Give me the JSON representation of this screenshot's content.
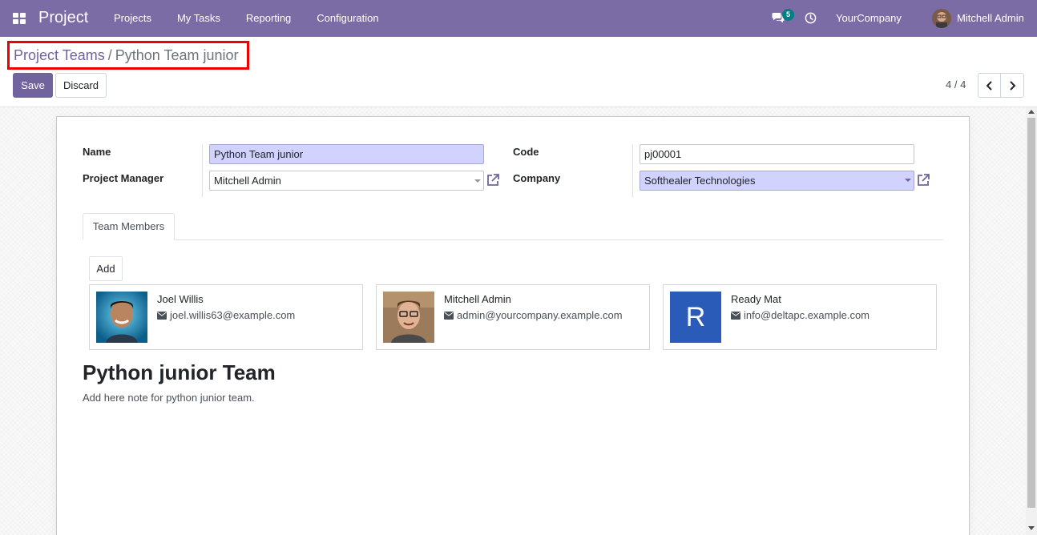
{
  "navbar": {
    "app_name": "Project",
    "menu": [
      "Projects",
      "My Tasks",
      "Reporting",
      "Configuration"
    ],
    "chat_badge": "5",
    "company": "YourCompany",
    "user": "Mitchell Admin",
    "bg_color": "#7c6ca6"
  },
  "breadcrumb": {
    "parent": "Project Teams",
    "separator": "/",
    "current": "Python Team junior"
  },
  "actions": {
    "save": "Save",
    "discard": "Discard"
  },
  "pager": {
    "value": "4 / 4"
  },
  "form": {
    "name_label": "Name",
    "name_value": "Python Team junior",
    "manager_label": "Project Manager",
    "manager_value": "Mitchell Admin",
    "code_label": "Code",
    "code_value": "pj00001",
    "company_label": "Company",
    "company_value": "Softhealer Technologies"
  },
  "tabs": [
    "Team Members"
  ],
  "members": {
    "add_label": "Add",
    "items": [
      {
        "name": "Joel Willis",
        "email": "joel.willis63@example.com",
        "avatar": "photo"
      },
      {
        "name": "Mitchell Admin",
        "email": "admin@yourcompany.example.com",
        "avatar": "photo"
      },
      {
        "name": "Ready Mat",
        "email": "info@deltapc.example.com",
        "avatar": "R"
      }
    ]
  },
  "note": {
    "title": "Python junior Team",
    "text": "Add here note for python junior team."
  },
  "colors": {
    "primary": "#71639e",
    "required_field": "#d2d2ff",
    "highlight_border": "#ee0000",
    "badge": "#017e84"
  }
}
